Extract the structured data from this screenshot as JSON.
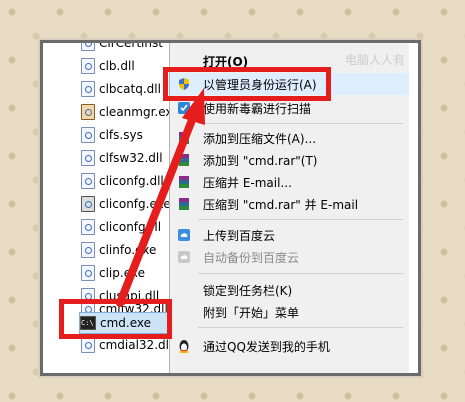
{
  "files": [
    {
      "name": "ClrCertinst",
      "icon": "dll-icon"
    },
    {
      "name": "clb.dll",
      "icon": "dll-icon"
    },
    {
      "name": "clbcatq.dll",
      "icon": "dll-icon"
    },
    {
      "name": "cleanmgr.exe",
      "icon": "broom-icon"
    },
    {
      "name": "clfs.sys",
      "icon": "sys-icon"
    },
    {
      "name": "clfsw32.dll",
      "icon": "dll-icon"
    },
    {
      "name": "cliconfg.dll",
      "icon": "dll-icon"
    },
    {
      "name": "cliconfg.exe",
      "icon": "config-icon"
    },
    {
      "name": "cliconfg.rll",
      "icon": "dll-icon"
    },
    {
      "name": "clinfo.exe",
      "icon": "exe-icon"
    },
    {
      "name": "clip.exe",
      "icon": "exe-icon"
    },
    {
      "name": "clusapi.dll",
      "icon": "dll-icon"
    },
    {
      "name": "cmifw32.dll",
      "icon": "dll-icon"
    },
    {
      "name": "cmd.exe",
      "icon": "cmd-icon"
    },
    {
      "name": "cmdial32.dll",
      "icon": "dll-icon"
    }
  ],
  "menu": {
    "open": "打开(O)",
    "run_as_admin": "以管理员身份运行(A)",
    "scan_virus": "使用新毒霸进行扫描",
    "add_to_archive": "添加到压缩文件(A)...",
    "add_to_rar": "添加到 \"cmd.rar\"(T)",
    "compress_email": "压缩并 E-mail...",
    "compress_rar_email": "压缩到 \"cmd.rar\" 并 E-mail",
    "upload_baidu": "上传到百度云",
    "auto_backup_baidu": "自动备份到百度云",
    "pin_taskbar": "锁定到任务栏(K)",
    "pin_start": "附到「开始」菜单",
    "send_qq": "通过QQ发送到我的手机"
  },
  "watermark": "电脑人人有",
  "colors": {
    "accent_red": "#e51d1d",
    "menu_bg": "#f0f0f0",
    "selection": "#cde4f7"
  }
}
